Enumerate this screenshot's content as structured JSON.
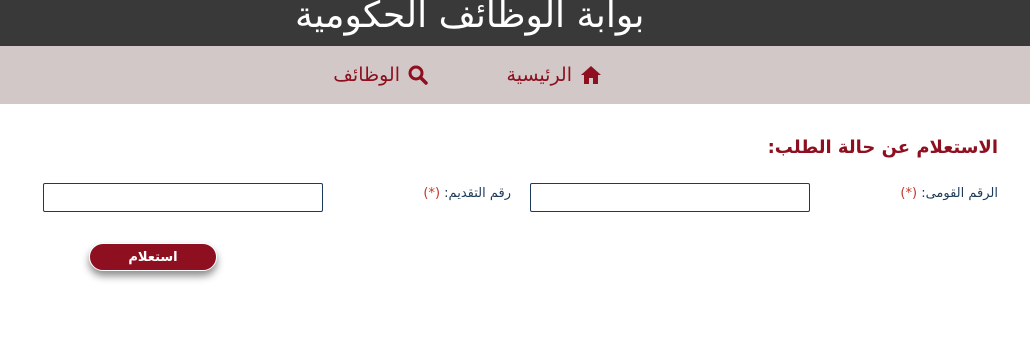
{
  "header": {
    "site_title": "بوابة الوظائف الحكومية"
  },
  "nav": {
    "items": [
      {
        "label": "الرئيسية",
        "icon": "home-icon"
      },
      {
        "label": "الوظائف",
        "icon": "search-icon"
      }
    ]
  },
  "form": {
    "section_title": "الاستعلام عن حالة الطلب:",
    "national_id": {
      "label": "الرقم القومى:",
      "required_mark": "(*)",
      "value": ""
    },
    "application_number": {
      "label": "رقم التقديم:",
      "required_mark": "(*)",
      "value": ""
    },
    "submit_label": "استعلام"
  },
  "colors": {
    "header_bg": "#393939",
    "nav_bg": "#d3c8c8",
    "accent": "#8e1020",
    "label_text": "#1c3a5a"
  }
}
